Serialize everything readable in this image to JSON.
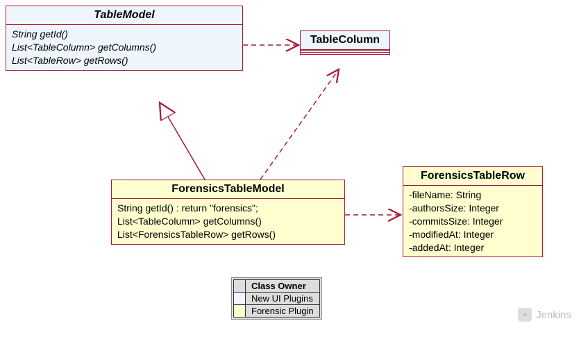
{
  "classes": {
    "tableModel": {
      "name": "TableModel",
      "methods": [
        "String getId()",
        "List<TableColumn> getColumns()",
        "List<TableRow> getRows()"
      ]
    },
    "tableColumn": {
      "name": "TableColumn"
    },
    "forensicsTableModel": {
      "name": "ForensicsTableModel",
      "methods": [
        "String getId() : return \"forensics\";",
        "List<TableColumn> getColumns()",
        "List<ForensicsTableRow> getRows()"
      ]
    },
    "forensicsTableRow": {
      "name": "ForensicsTableRow",
      "attributes": [
        "-fileName: String",
        "-authorsSize: Integer",
        "-commitsSize: Integer",
        "-modifiedAt: Integer",
        "-addedAt: Integer"
      ]
    }
  },
  "legend": {
    "title": "Class Owner",
    "rows": [
      {
        "color": "blue",
        "label": "New UI Plugins"
      },
      {
        "color": "yellow",
        "label": "Forensic Plugin"
      }
    ]
  },
  "watermark": "Jenkins",
  "chart_data": {
    "type": "uml-class-diagram",
    "legend_title": "Class Owner",
    "categories": {
      "New UI Plugins": {
        "color": "#eff5fc"
      },
      "Forensic Plugin": {
        "color": "#fefece"
      }
    },
    "classes": [
      {
        "id": "TableModel",
        "category": "New UI Plugins",
        "stereotype": "abstract",
        "methods": [
          "String getId()",
          "List<TableColumn> getColumns()",
          "List<TableRow> getRows()"
        ]
      },
      {
        "id": "TableColumn",
        "category": "New UI Plugins"
      },
      {
        "id": "ForensicsTableModel",
        "category": "Forensic Plugin",
        "methods": [
          "String getId() : return \"forensics\";",
          "List<TableColumn> getColumns()",
          "List<ForensicsTableRow> getRows()"
        ]
      },
      {
        "id": "ForensicsTableRow",
        "category": "Forensic Plugin",
        "attributes": [
          "-fileName: String",
          "-authorsSize: Integer",
          "-commitsSize: Integer",
          "-modifiedAt: Integer",
          "-addedAt: Integer"
        ]
      }
    ],
    "relations": [
      {
        "from": "ForensicsTableModel",
        "to": "TableModel",
        "type": "generalization"
      },
      {
        "from": "TableModel",
        "to": "TableColumn",
        "type": "dependency"
      },
      {
        "from": "ForensicsTableModel",
        "to": "TableColumn",
        "type": "dependency"
      },
      {
        "from": "ForensicsTableModel",
        "to": "ForensicsTableRow",
        "type": "dependency"
      }
    ]
  }
}
